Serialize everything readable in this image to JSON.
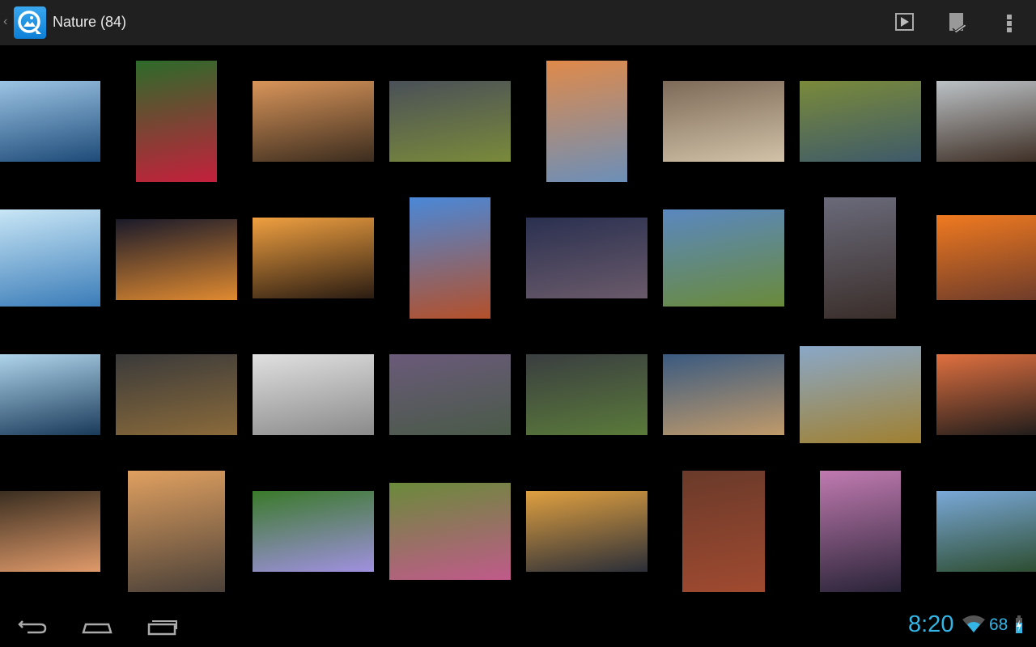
{
  "header": {
    "title": "Nature (84)"
  },
  "status": {
    "time": "8:20",
    "battery": "68"
  },
  "colors": {
    "accent": "#33b5e5",
    "actionbar": "#202020"
  },
  "photos": [
    [
      "#9cc4e4",
      "#1d4a78"
    ],
    [
      "#2d6b2a",
      "#c4203c"
    ],
    [
      "#d9955a",
      "#3b2c1e"
    ],
    [
      "#4a5058",
      "#7a8a3a"
    ],
    [
      "#e08a4a",
      "#6c8fb8"
    ],
    [
      "#7d6a58",
      "#d2c2a8"
    ],
    [
      "#7a8a3a",
      "#3e5a6a"
    ],
    [
      "#bcc2c6",
      "#3a2a20"
    ],
    [
      "#c8e6f6",
      "#3a7cb8"
    ],
    [
      "#1a1a2a",
      "#e08a30"
    ],
    [
      "#f0a040",
      "#2a1c12"
    ],
    [
      "#4a88d8",
      "#b4502a"
    ],
    [
      "#2a3050",
      "#6a5a6a"
    ],
    [
      "#5a88c0",
      "#6a8a3a"
    ],
    [
      "#6a6a7a",
      "#3a2e2a"
    ],
    [
      "#f07a20",
      "#6a3a2a"
    ],
    [
      "#aed4ea",
      "#1a3a5a"
    ],
    [
      "#3a3a3a",
      "#8a6a3a"
    ],
    [
      "#e0e0e0",
      "#8a8a8a"
    ],
    [
      "#6a5a7a",
      "#4a5a48"
    ],
    [
      "#3a3e40",
      "#5a7a3a"
    ],
    [
      "#3a5a80",
      "#c09a6a"
    ],
    [
      "#8aa8c8",
      "#a08030"
    ],
    [
      "#e07040",
      "#1a1a1a"
    ],
    [
      "#3a2e20",
      "#e09a6a"
    ],
    [
      "#e0a060",
      "#4a4038"
    ],
    [
      "#3a7a2a",
      "#a090e0"
    ],
    [
      "#6a8a3a",
      "#c05a8a"
    ],
    [
      "#e0a040",
      "#2a2e38"
    ],
    [
      "#6a3a2a",
      "#a04a30"
    ],
    [
      "#c07ab0",
      "#2a2438"
    ],
    [
      "#7aa8d8",
      "#2a4a2a"
    ]
  ]
}
